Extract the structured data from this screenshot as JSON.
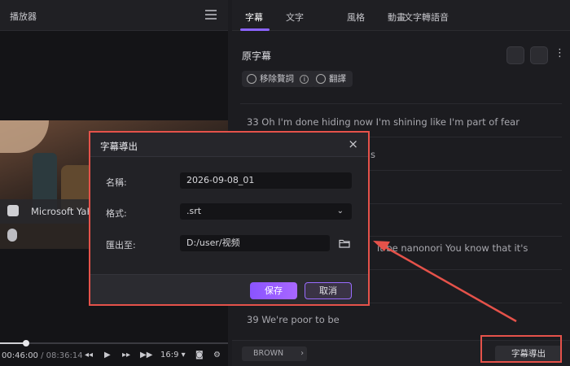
{
  "player": {
    "title": "播放器",
    "subtitle_font": "Microsoft YaHe",
    "time_current": "00:46:00",
    "time_separator": "/",
    "time_total": "08:36:14",
    "aspect": "16:9"
  },
  "panel": {
    "tabs": [
      {
        "label": "字幕"
      },
      {
        "label": "文字"
      },
      {
        "label": "風格"
      },
      {
        "label": "動畫"
      },
      {
        "label": "文字轉語音"
      }
    ],
    "section_title": "原字幕",
    "remove_fillers_label": "移除贅詞",
    "translate_label": "翻譯",
    "rows": [
      {
        "text": "33  Oh I'm done hiding now I'm shining like I'm part of fear"
      },
      {
        "text": "s"
      },
      {
        "text": ""
      },
      {
        "text": ""
      },
      {
        "text": "it be nanonori You know that it's"
      },
      {
        "text": ""
      },
      {
        "text": "39  We're poor to be"
      }
    ],
    "style_chip": "BROWN",
    "export_button": "字幕導出"
  },
  "dialog": {
    "title": "字幕導出",
    "name_label": "名稱:",
    "name_value": "2026-09-08_01",
    "format_label": "格式:",
    "format_value": ".srt",
    "path_label": "匯出至:",
    "path_value": "D:/user/视频",
    "save_label": "保存",
    "cancel_label": "取消"
  },
  "colors": {
    "accent": "#8b63ff",
    "highlight": "#e5524a"
  }
}
